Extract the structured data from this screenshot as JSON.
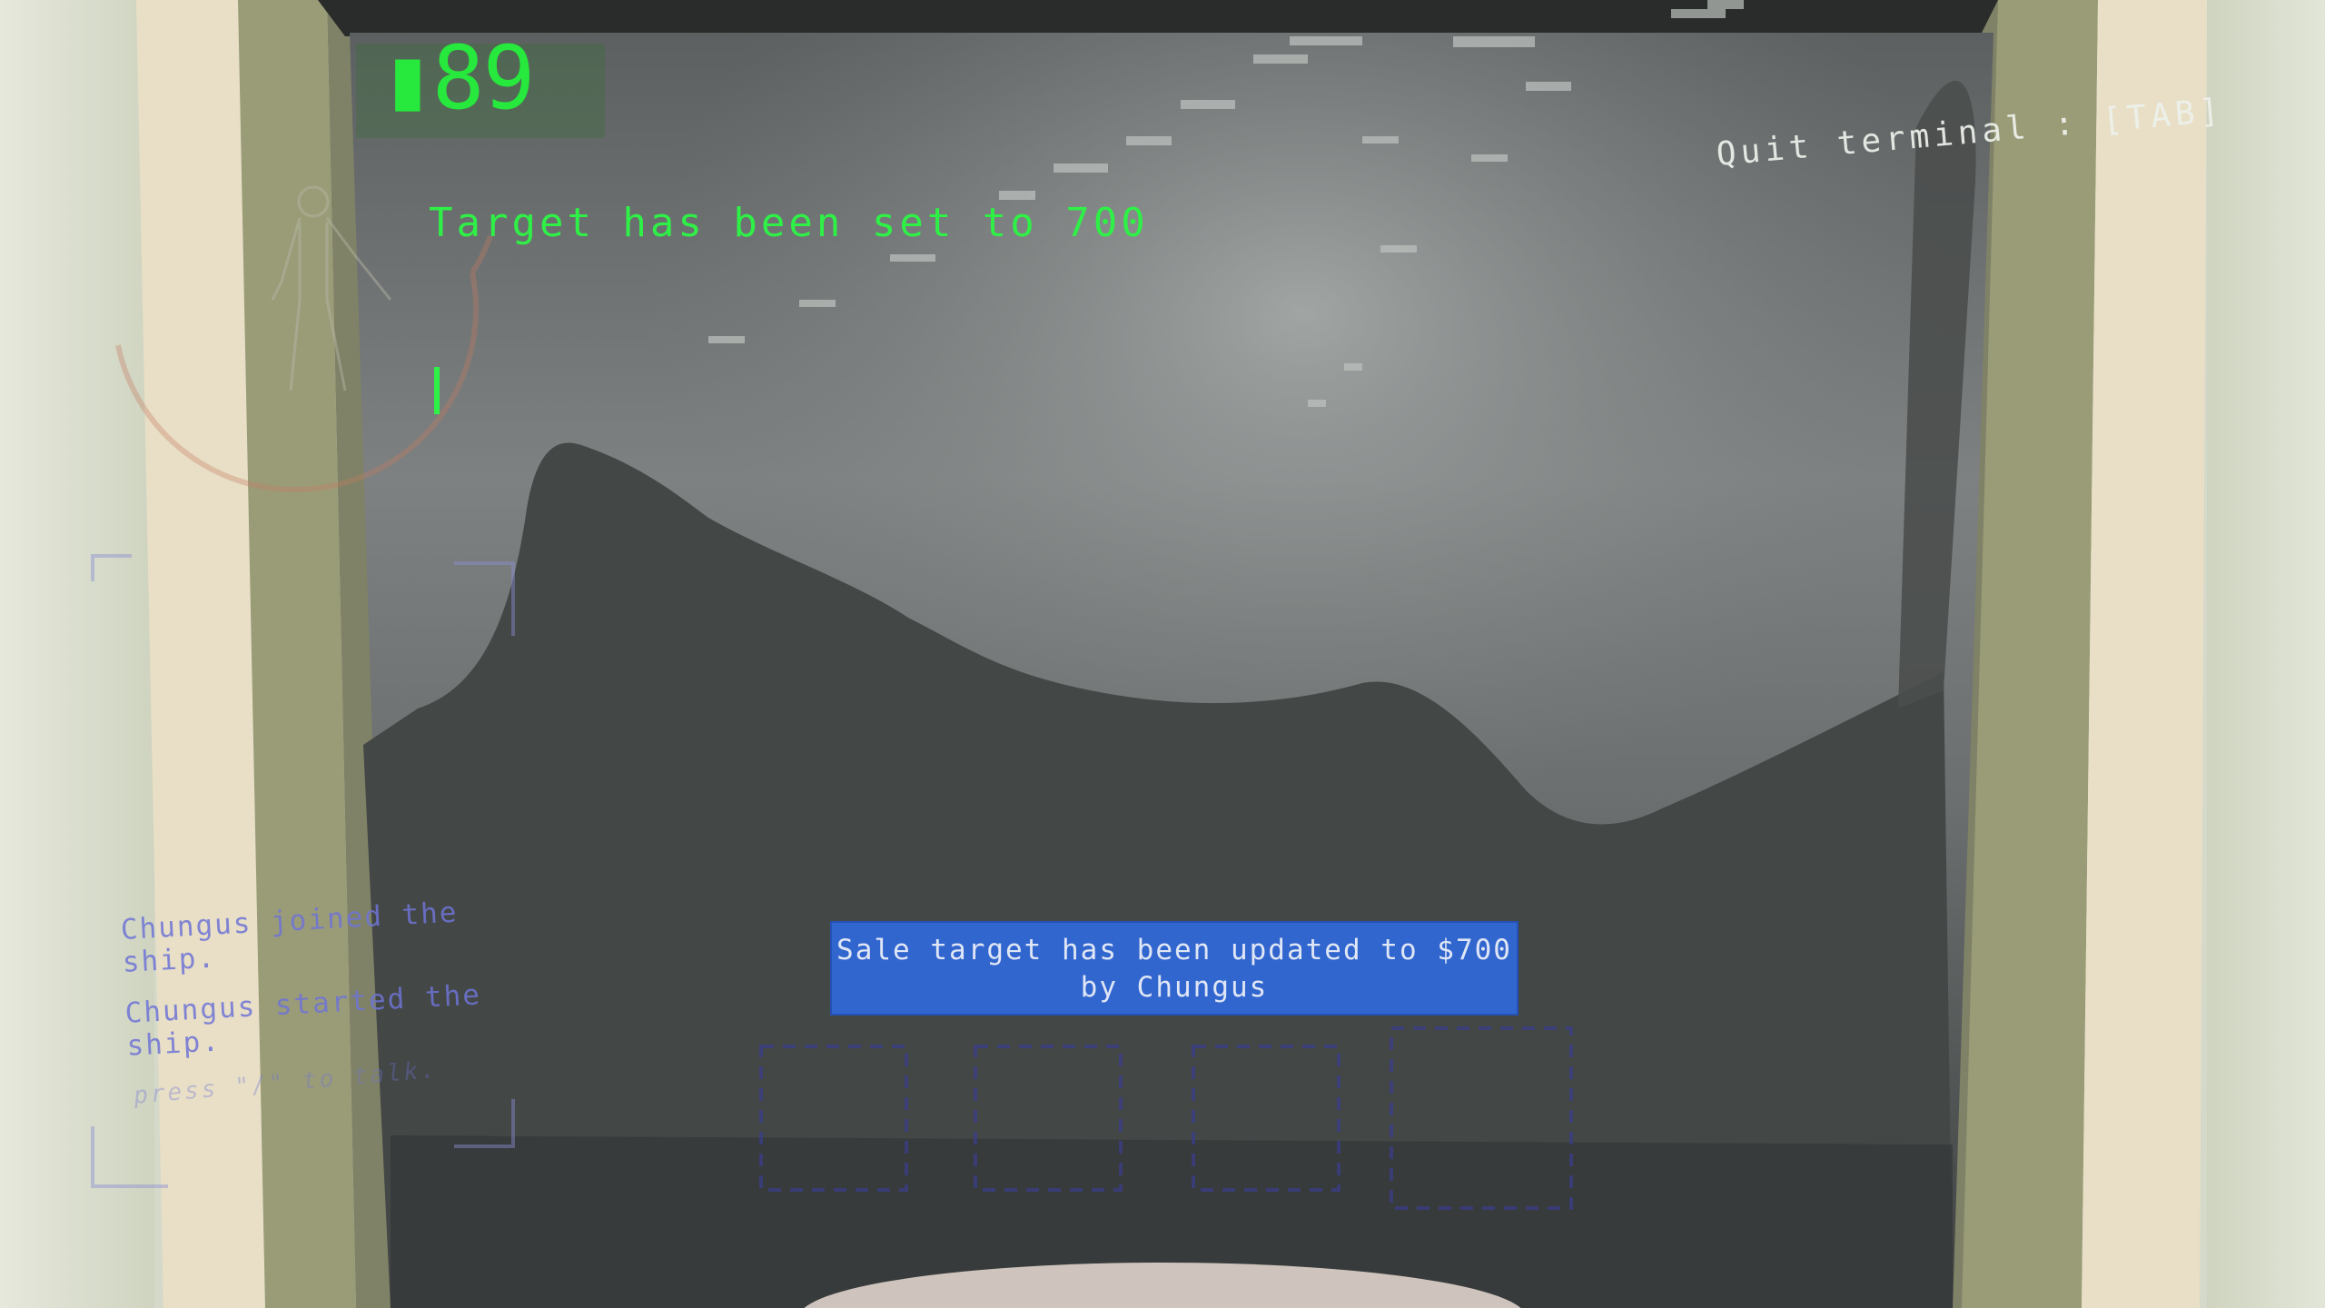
{
  "hud": {
    "credits": "▮89",
    "quit_hint": "Quit terminal : [TAB]"
  },
  "terminal": {
    "message": "Target has been set to 700"
  },
  "chat": {
    "messages": [
      "Chungus joined the ship.",
      "Chungus started the ship."
    ],
    "hint": "press \"/\" to talk."
  },
  "notification": {
    "line1": "Sale target has been updated to $700",
    "line2": "by Chungus"
  },
  "colors": {
    "terminal_green": "#2ff046",
    "notice_blue": "#3266cf",
    "chat_purple": "#6f74d6"
  },
  "icons": {
    "player_silhouette": "player-silhouette-icon",
    "compass_ring": "compass-ring-icon"
  }
}
